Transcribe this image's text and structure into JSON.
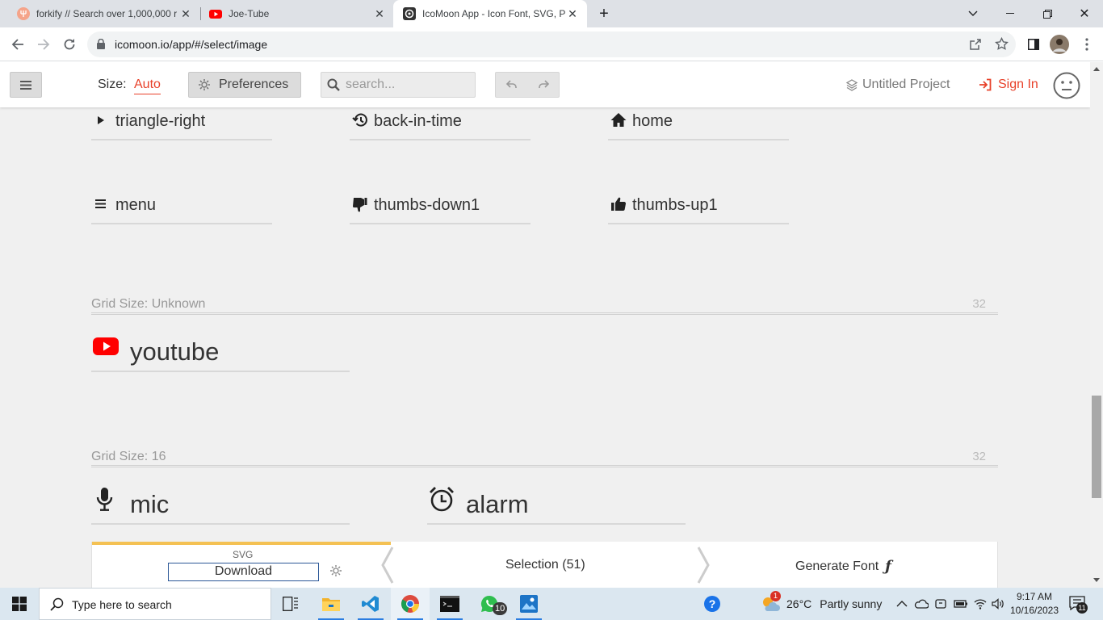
{
  "browser": {
    "tabs": [
      {
        "title": "forkify // Search over 1,000,000 r",
        "favicon": "forkify-icon",
        "active": false
      },
      {
        "title": "Joe-Tube",
        "favicon": "youtube-icon",
        "active": false
      },
      {
        "title": "IcoMoon App - Icon Font, SVG, P",
        "favicon": "icomoon-icon",
        "active": true
      }
    ],
    "url": "icomoon.io/app/#/select/image"
  },
  "appbar": {
    "size_label": "Size:",
    "size_value": "Auto",
    "preferences_label": "Preferences",
    "search_placeholder": "search...",
    "project_label": "Untitled Project",
    "signin_label": "Sign In"
  },
  "icon_rows": {
    "row1": [
      {
        "name": "triangle-right",
        "icon": "triangle-right-icon"
      },
      {
        "name": "back-in-time",
        "icon": "back-in-time-icon"
      },
      {
        "name": "home",
        "icon": "home-icon"
      }
    ],
    "row2": [
      {
        "name": "menu",
        "icon": "menu-icon"
      },
      {
        "name": "thumbs-down1",
        "icon": "thumbs-down-icon"
      },
      {
        "name": "thumbs-up1",
        "icon": "thumbs-up-icon"
      }
    ]
  },
  "sets": [
    {
      "title": "Grid Size: Unknown",
      "count": "32",
      "icons": [
        {
          "name": "youtube",
          "icon": "youtube-icon"
        }
      ]
    },
    {
      "title": "Grid Size: 16",
      "count": "32",
      "icons": [
        {
          "name": "mic",
          "icon": "mic-icon"
        },
        {
          "name": "alarm",
          "icon": "alarm-icon"
        }
      ]
    }
  ],
  "bottombar": {
    "format_label": "SVG",
    "download_label": "Download",
    "selection_label": "Selection (51)",
    "generate_label": "Generate Font",
    "progress_fraction": 0.33
  },
  "taskbar": {
    "search_placeholder": "Type here to search",
    "whatsapp_badge": "10",
    "weather_badge": "1",
    "temperature": "26°C",
    "weather": "Partly sunny",
    "time": "9:17 AM",
    "date": "10/16/2023",
    "notifications": "11"
  },
  "colors": {
    "accent": "#e8412a",
    "youtube_red": "#ff0000",
    "progress": "#f4c153",
    "page_bg": "#f0f0f0"
  }
}
